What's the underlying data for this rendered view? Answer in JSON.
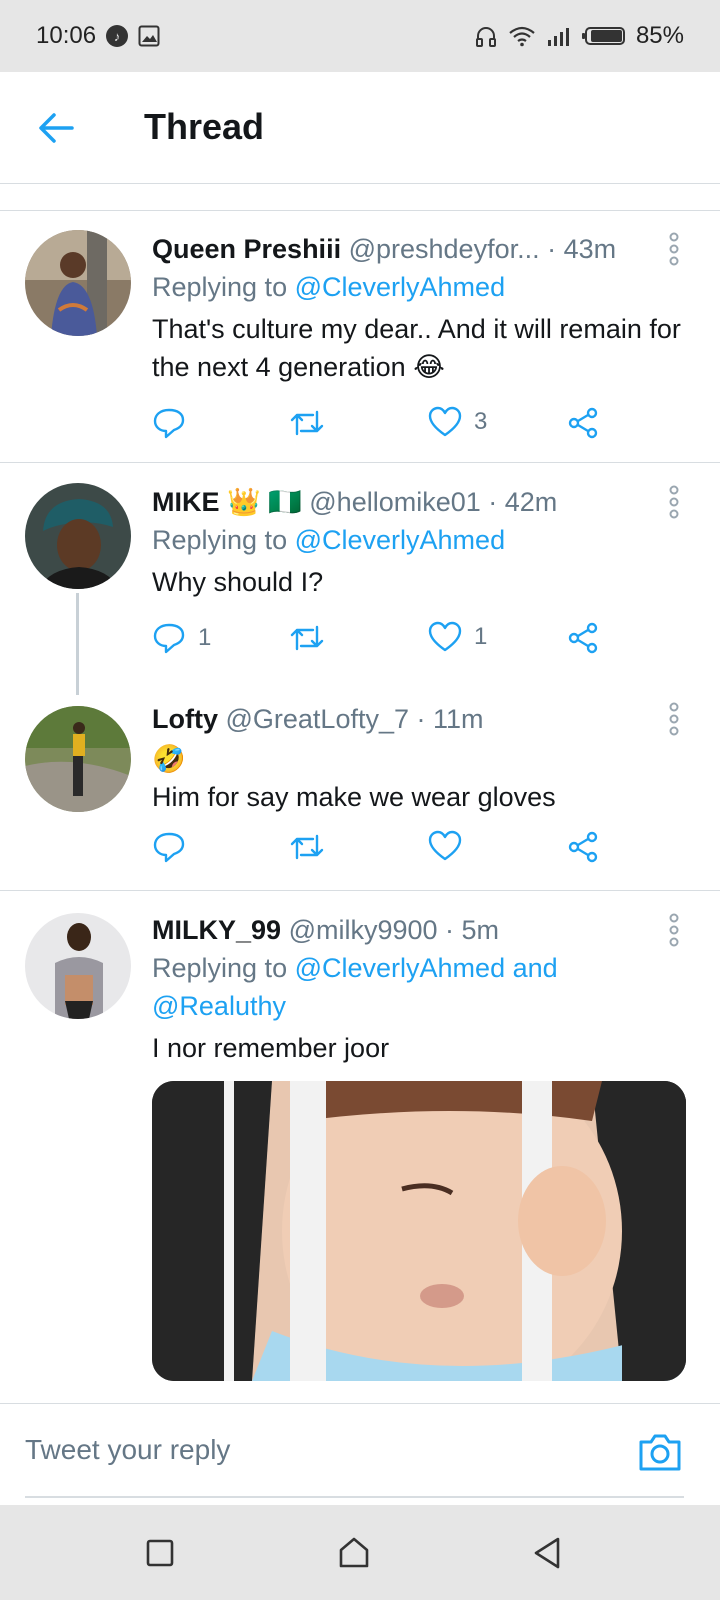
{
  "status_bar": {
    "time": "10:06",
    "battery": "85%"
  },
  "header": {
    "title": "Thread"
  },
  "tweets": [
    {
      "name": "Queen Preshiii",
      "handle": "@preshdeyfor...",
      "time": "· 43m",
      "replying_prefix": "Replying to",
      "replying_to": "@CleverlyAhmed",
      "text": "That's culture my dear.. And it will remain for the next 4 generation 😂",
      "replies": "",
      "retweets": "",
      "likes": "3"
    },
    {
      "name": "MIKE 👑 🇳🇬",
      "handle": "@hellomike01",
      "time": "· 42m",
      "replying_prefix": "Replying to",
      "replying_to": "@CleverlyAhmed",
      "text": "Why should I?",
      "replies": "1",
      "retweets": "",
      "likes": "1"
    },
    {
      "name": "Lofty",
      "handle": "@GreatLofty_7",
      "time": "· 11m",
      "emoji": "🤣",
      "text": "Him for say make we wear gloves",
      "replies": "",
      "retweets": "",
      "likes": ""
    },
    {
      "name": "MILKY_99",
      "handle": "@milky9900",
      "time": "· 5m",
      "replying_prefix": "Replying to",
      "replying_to": "@CleverlyAhmed and",
      "replying_to_2": "@Realuthy",
      "text": "I nor remember joor"
    }
  ],
  "reply_box": {
    "placeholder": "Tweet your reply"
  },
  "icons": {
    "back": "back-arrow-icon",
    "more": "more-vertical-icon",
    "reply": "reply-icon",
    "retweet": "retweet-icon",
    "like": "heart-icon",
    "share": "share-icon",
    "camera": "camera-icon"
  },
  "colors": {
    "accent": "#1da1f2",
    "muted": "#657786",
    "text": "#14171a"
  }
}
